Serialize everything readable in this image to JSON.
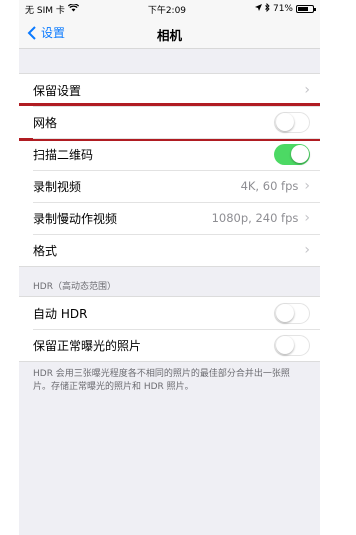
{
  "status": {
    "carrier": "无 SIM 卡",
    "time": "下午2:09",
    "battery": "71%",
    "battery_level": 0.71
  },
  "nav": {
    "back_label": "设置",
    "title": "相机"
  },
  "group1": {
    "preserve_settings": "保留设置",
    "grid": "网格",
    "grid_on": false,
    "scan_qr": "扫描二维码",
    "scan_qr_on": true,
    "record_video": "录制视频",
    "record_video_value": "4K, 60 fps",
    "record_slomo": "录制慢动作视频",
    "record_slomo_value": "1080p, 240 fps",
    "formats": "格式"
  },
  "hdr": {
    "header": "HDR（高动态范围）",
    "auto_hdr": "自动 HDR",
    "auto_hdr_on": false,
    "keep_normal": "保留正常曝光的照片",
    "keep_normal_on": false,
    "footer": "HDR 会用三张曝光程度各不相同的照片的最佳部分合并出一张照片。存储正常曝光的照片和 HDR 照片。"
  },
  "colors": {
    "accent": "#0a7aff",
    "toggle_on": "#4cd964",
    "highlight": "#b01c22"
  }
}
